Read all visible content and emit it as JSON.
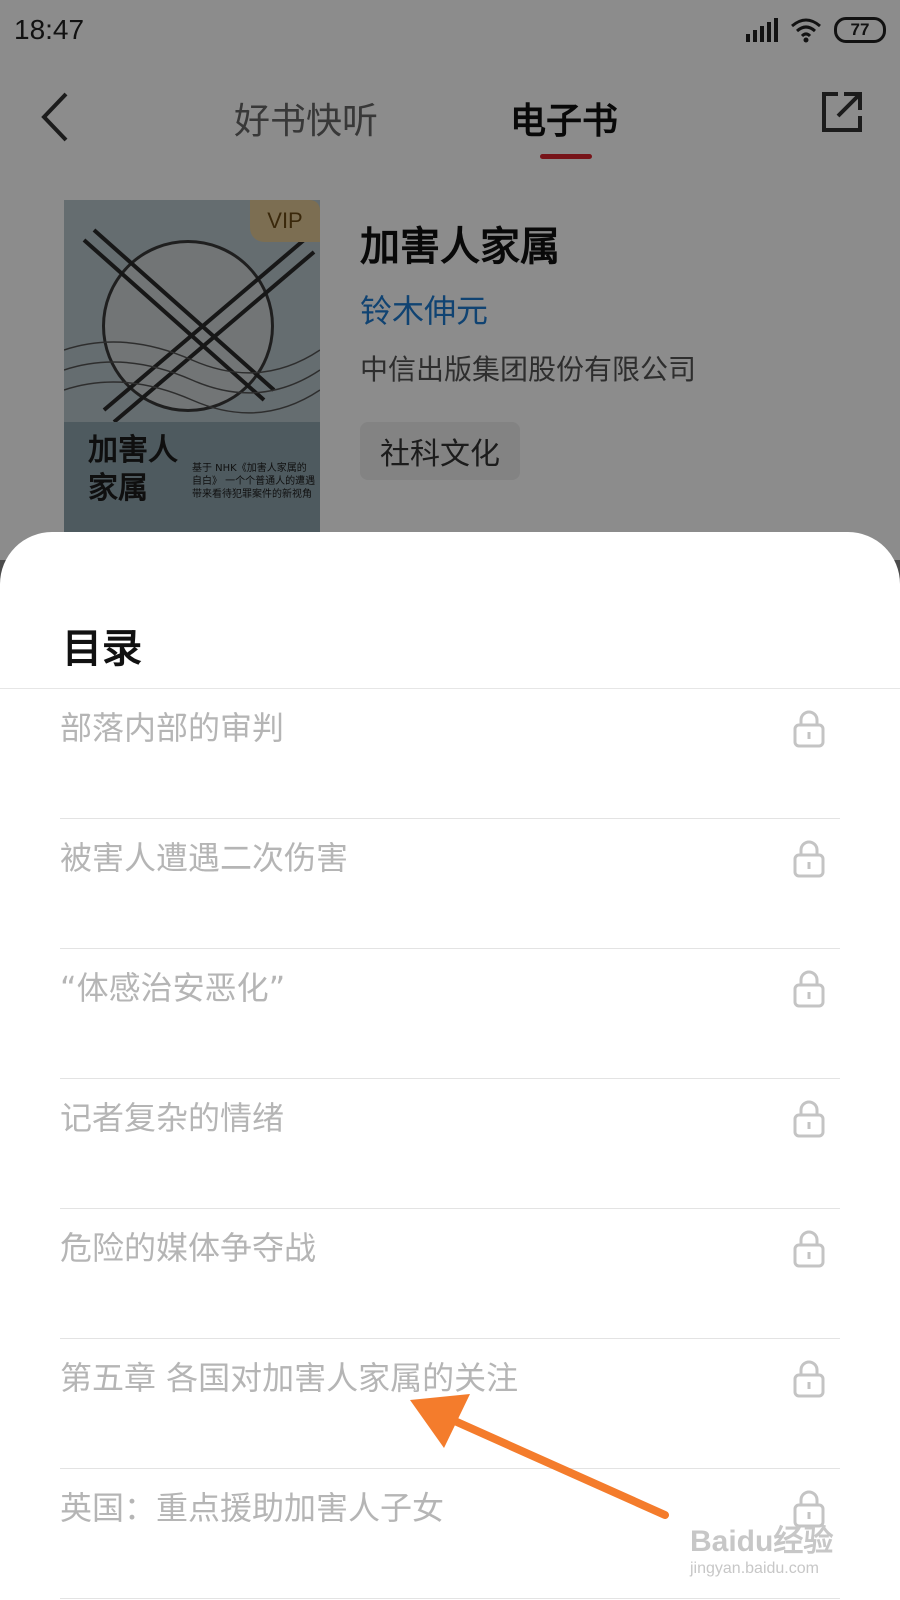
{
  "status_bar": {
    "time": "18:47",
    "battery": "77"
  },
  "nav": {
    "tabs": [
      {
        "label": "好书快听"
      },
      {
        "label": "电子书"
      }
    ]
  },
  "book": {
    "title": "加害人家属",
    "author": "铃木伸元",
    "publisher": "中信出版集团股份有限公司",
    "tag": "社科文化",
    "cover": {
      "badge": "VIP",
      "title": "加害人家属",
      "desc": "基于 NHK《加害人家属的自白》 一个个普通人的遭遇 带来看待犯罪案件的新视角"
    }
  },
  "toc": {
    "title": "目录",
    "items": [
      {
        "label": "部落内部的审判",
        "locked": true
      },
      {
        "label": "被害人遭遇二次伤害",
        "locked": true
      },
      {
        "label": "“体感治安恶化”",
        "locked": true
      },
      {
        "label": "记者复杂的情绪",
        "locked": true
      },
      {
        "label": "危险的媒体争夺战",
        "locked": true
      },
      {
        "label": "第五章 各国对加害人家属的关注",
        "locked": true
      },
      {
        "label": "英国：重点援助加害人子女",
        "locked": true
      }
    ]
  },
  "annotation": {
    "color": "#f47c2c"
  },
  "watermark": {
    "logo": "Baidu经验",
    "url": "jingyan.baidu.com"
  }
}
